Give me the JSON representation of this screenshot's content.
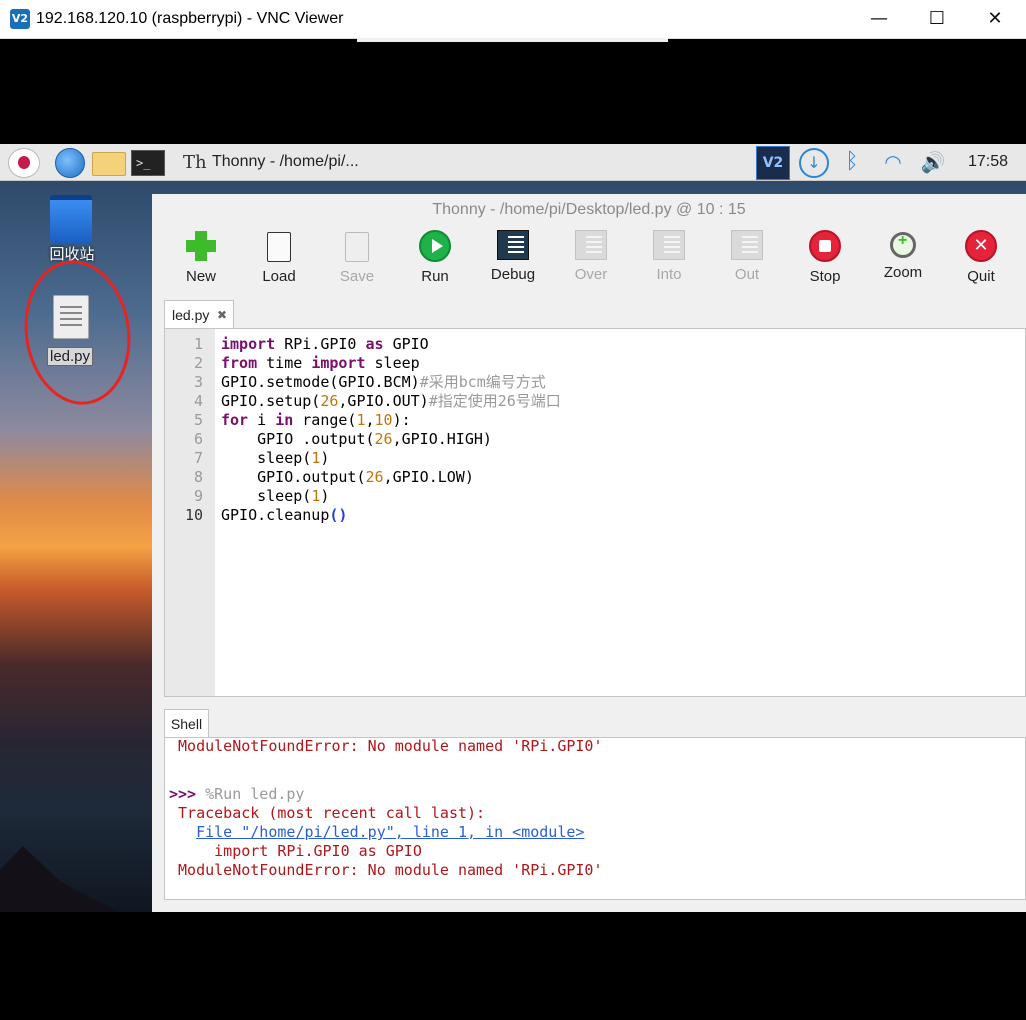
{
  "vnc": {
    "logo": "V2",
    "title": "192.168.120.10 (raspberrypi) - VNC Viewer",
    "minimize": "—",
    "maximize": "☐",
    "close": "✕"
  },
  "taskbar": {
    "task_label": "Thonny  -  /home/pi/...",
    "vnc_icon_text": "V2",
    "clock": "17:58",
    "icons": [
      "raspberry-menu-icon",
      "web-browser-icon",
      "file-manager-icon",
      "terminal-icon",
      "thonny-icon",
      "vnc-server-icon",
      "download-icon",
      "bluetooth-icon",
      "wifi-icon",
      "volume-icon"
    ]
  },
  "desktop": {
    "recycle_bin_label": "回收站",
    "file_label": "led.py",
    "annotation_color": "#e8241f"
  },
  "thonny": {
    "title": "Thonny  -  /home/pi/Desktop/led.py  @  10 : 15",
    "toolbar": [
      {
        "label": "New",
        "enabled": true
      },
      {
        "label": "Load",
        "enabled": true
      },
      {
        "label": "Save",
        "enabled": false
      },
      {
        "label": "Run",
        "enabled": true
      },
      {
        "label": "Debug",
        "enabled": true
      },
      {
        "label": "Over",
        "enabled": false
      },
      {
        "label": "Into",
        "enabled": false
      },
      {
        "label": "Out",
        "enabled": false
      },
      {
        "label": "Stop",
        "enabled": true
      },
      {
        "label": "Zoom",
        "enabled": true
      },
      {
        "label": "Quit",
        "enabled": true
      }
    ],
    "editor_tab": "led.py",
    "editor_tab_close": "✖",
    "line_numbers": [
      "1",
      "2",
      "3",
      "4",
      "5",
      "6",
      "7",
      "8",
      "9",
      "10"
    ],
    "code_lines": [
      [
        {
          "t": "import",
          "c": "kw"
        },
        {
          "t": " RPi.GPI0 ",
          "c": ""
        },
        {
          "t": "as",
          "c": "kw"
        },
        {
          "t": " GPIO",
          "c": ""
        }
      ],
      [
        {
          "t": "from",
          "c": "kw"
        },
        {
          "t": " time ",
          "c": ""
        },
        {
          "t": "import",
          "c": "kw"
        },
        {
          "t": " sleep",
          "c": ""
        }
      ],
      [
        {
          "t": "GPIO.setmode(GPIO.BCM)",
          "c": ""
        },
        {
          "t": "#采用bcm编号方式",
          "c": "cm"
        }
      ],
      [
        {
          "t": "GPIO.setup(",
          "c": ""
        },
        {
          "t": "26",
          "c": "num"
        },
        {
          "t": ",GPIO.OUT)",
          "c": ""
        },
        {
          "t": "#指定使用26号端口",
          "c": "cm"
        }
      ],
      [
        {
          "t": "for",
          "c": "kw"
        },
        {
          "t": " i ",
          "c": ""
        },
        {
          "t": "in",
          "c": "kw"
        },
        {
          "t": " range(",
          "c": ""
        },
        {
          "t": "1",
          "c": "num"
        },
        {
          "t": ",",
          "c": ""
        },
        {
          "t": "10",
          "c": "num"
        },
        {
          "t": "):",
          "c": ""
        }
      ],
      [
        {
          "t": "    GPIO .output(",
          "c": ""
        },
        {
          "t": "26",
          "c": "num"
        },
        {
          "t": ",GPIO.HIGH)",
          "c": ""
        }
      ],
      [
        {
          "t": "    sleep(",
          "c": ""
        },
        {
          "t": "1",
          "c": "num"
        },
        {
          "t": ")",
          "c": ""
        }
      ],
      [
        {
          "t": "    GPIO.output(",
          "c": ""
        },
        {
          "t": "26",
          "c": "num"
        },
        {
          "t": ",GPIO.LOW)",
          "c": ""
        }
      ],
      [
        {
          "t": "    sleep(",
          "c": ""
        },
        {
          "t": "1",
          "c": "num"
        },
        {
          "t": ")",
          "c": ""
        }
      ],
      [
        {
          "t": "GPIO.cleanup",
          "c": ""
        },
        {
          "t": "()",
          "c": "br"
        }
      ]
    ],
    "shell_tab": "Shell",
    "shell_lines": [
      [
        {
          "t": " ModuleNotFoundError: No module named 'RPi.GPI0'",
          "c": "err"
        }
      ],
      [],
      [
        {
          "t": ">>>",
          "c": "prompt"
        },
        {
          "t": " %Run led.py",
          "c": "cmd"
        }
      ],
      [
        {
          "t": " Traceback (most recent call last):",
          "c": "err"
        }
      ],
      [
        {
          "t": "   ",
          "c": ""
        },
        {
          "t": "File \"/home/pi/led.py\", line 1, in <module>",
          "c": "link"
        }
      ],
      [
        {
          "t": "     import RPi.GPI0 as GPIO",
          "c": "err"
        }
      ],
      [
        {
          "t": " ModuleNotFoundError: No module named 'RPi.GPI0'",
          "c": "err"
        }
      ],
      [],
      [
        {
          "t": ">>>",
          "c": "prompt"
        }
      ]
    ]
  }
}
